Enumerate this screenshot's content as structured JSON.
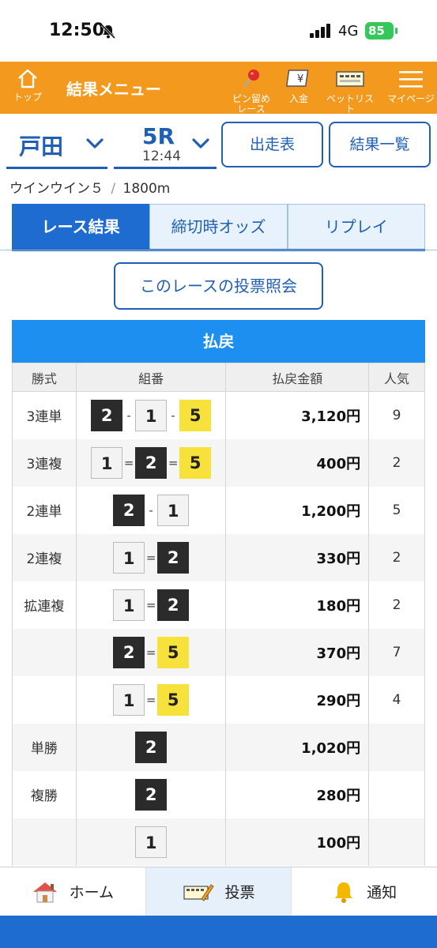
{
  "status": {
    "time": "12:50",
    "network": "4G",
    "battery": "85"
  },
  "header": {
    "home_label": "トップ",
    "title": "結果メニュー",
    "pin_label_1": "ピン留め",
    "pin_label_2": "レース",
    "deposit_label": "入金",
    "betlist_label": "ベットリスト",
    "mypage_label": "マイページ"
  },
  "selector": {
    "venue": "戸田",
    "race_number": "5R",
    "race_time": "12:44",
    "entries_button": "出走表",
    "results_button": "結果一覧"
  },
  "race_info": {
    "name": "ウインウイン５",
    "separator": "/",
    "distance": "1800m"
  },
  "tabs": [
    {
      "label": "レース結果",
      "active": true
    },
    {
      "label": "締切時オッズ",
      "active": false
    },
    {
      "label": "リプレイ",
      "active": false
    }
  ],
  "vote_button": "このレースの投票照会",
  "payout": {
    "title": "払戻",
    "headers": {
      "type": "勝式",
      "combo": "組番",
      "amount": "払戻金額",
      "popularity": "人気"
    },
    "rows": [
      {
        "type": "3連単",
        "combo": [
          "2",
          "-",
          "1",
          "-",
          "5"
        ],
        "amount": "3,120円",
        "popularity": "9"
      },
      {
        "type": "3連複",
        "combo": [
          "1",
          "=",
          "2",
          "=",
          "5"
        ],
        "amount": "400円",
        "popularity": "2"
      },
      {
        "type": "2連単",
        "combo": [
          "2",
          "-",
          "1"
        ],
        "amount": "1,200円",
        "popularity": "5"
      },
      {
        "type": "2連複",
        "combo": [
          "1",
          "=",
          "2"
        ],
        "amount": "330円",
        "popularity": "2"
      },
      {
        "type": "拡連複",
        "combo": [
          "1",
          "=",
          "2"
        ],
        "amount": "180円",
        "popularity": "2"
      },
      {
        "type": "",
        "combo": [
          "2",
          "=",
          "5"
        ],
        "amount": "370円",
        "popularity": "7"
      },
      {
        "type": "",
        "combo": [
          "1",
          "=",
          "5"
        ],
        "amount": "290円",
        "popularity": "4"
      },
      {
        "type": "単勝",
        "combo": [
          "2"
        ],
        "amount": "1,020円",
        "popularity": ""
      },
      {
        "type": "複勝",
        "combo": [
          "2"
        ],
        "amount": "280円",
        "popularity": ""
      },
      {
        "type": "",
        "combo": [
          "1"
        ],
        "amount": "100円",
        "popularity": ""
      }
    ]
  },
  "bottom_nav": {
    "home": "ホーム",
    "vote": "投票",
    "notify": "通知"
  },
  "colors": {
    "header_orange": "#f39a1e",
    "primary_blue": "#1f5fb4",
    "payout_header_blue": "#1d8ff0",
    "boat_1": "#f3f3f3",
    "boat_2": "#2b2b2b",
    "boat_5": "#f7e23b"
  }
}
